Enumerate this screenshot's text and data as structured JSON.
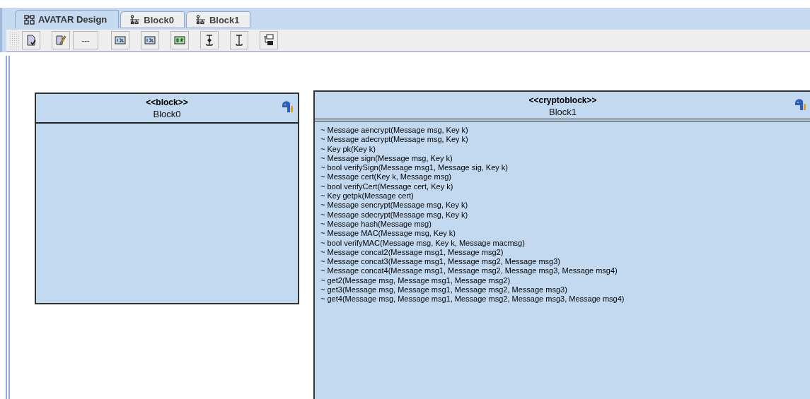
{
  "tabs": [
    {
      "label": "AVATAR Design",
      "selected": true,
      "kind": "diagram"
    },
    {
      "label": "Block0",
      "selected": false,
      "kind": "block"
    },
    {
      "label": "Block1",
      "selected": false,
      "kind": "block"
    }
  ],
  "toolbar": {
    "buttons": [
      {
        "kind": "icon"
      },
      {
        "kind": "icon"
      },
      {
        "kind": "text",
        "label": "---"
      },
      {
        "kind": "icon"
      },
      {
        "kind": "icon"
      },
      {
        "kind": "icon"
      },
      {
        "kind": "icon"
      },
      {
        "kind": "icon"
      },
      {
        "kind": "icon"
      }
    ]
  },
  "blocks": [
    {
      "stereotype": "<<block>>",
      "name": "Block0"
    },
    {
      "stereotype": "<<cryptoblock>>",
      "name": "Block1",
      "operations": [
        "~ Message aencrypt(Message msg, Key k)",
        "~ Message adecrypt(Message msg, Key k)",
        "~ Key pk(Key k)",
        "~ Message sign(Message msg, Key k)",
        "~ bool verifySign(Message msg1, Message sig, Key k)",
        "~ Message cert(Key k, Message msg)",
        "~ bool verifyCert(Message cert, Key k)",
        "~ Key getpk(Message cert)",
        "~ Message sencrypt(Message msg, Key k)",
        "~ Message sdecrypt(Message msg, Key k)",
        "~ Message hash(Message msg)",
        "~ Message MAC(Message msg, Key k)",
        "~ bool verifyMAC(Message msg, Key k, Message macmsg)",
        "~ Message concat2(Message msg1, Message msg2)",
        "~ Message concat3(Message msg1, Message msg2, Message msg3)",
        "~ Message concat4(Message msg1, Message msg2, Message msg3, Message msg4)",
        "~ get2(Message msg, Message msg1, Message msg2)",
        "~ get3(Message msg, Message msg1, Message msg2, Message msg3)",
        "~ get4(Message msg, Message msg1, Message msg2, Message msg3, Message msg4)"
      ]
    }
  ]
}
